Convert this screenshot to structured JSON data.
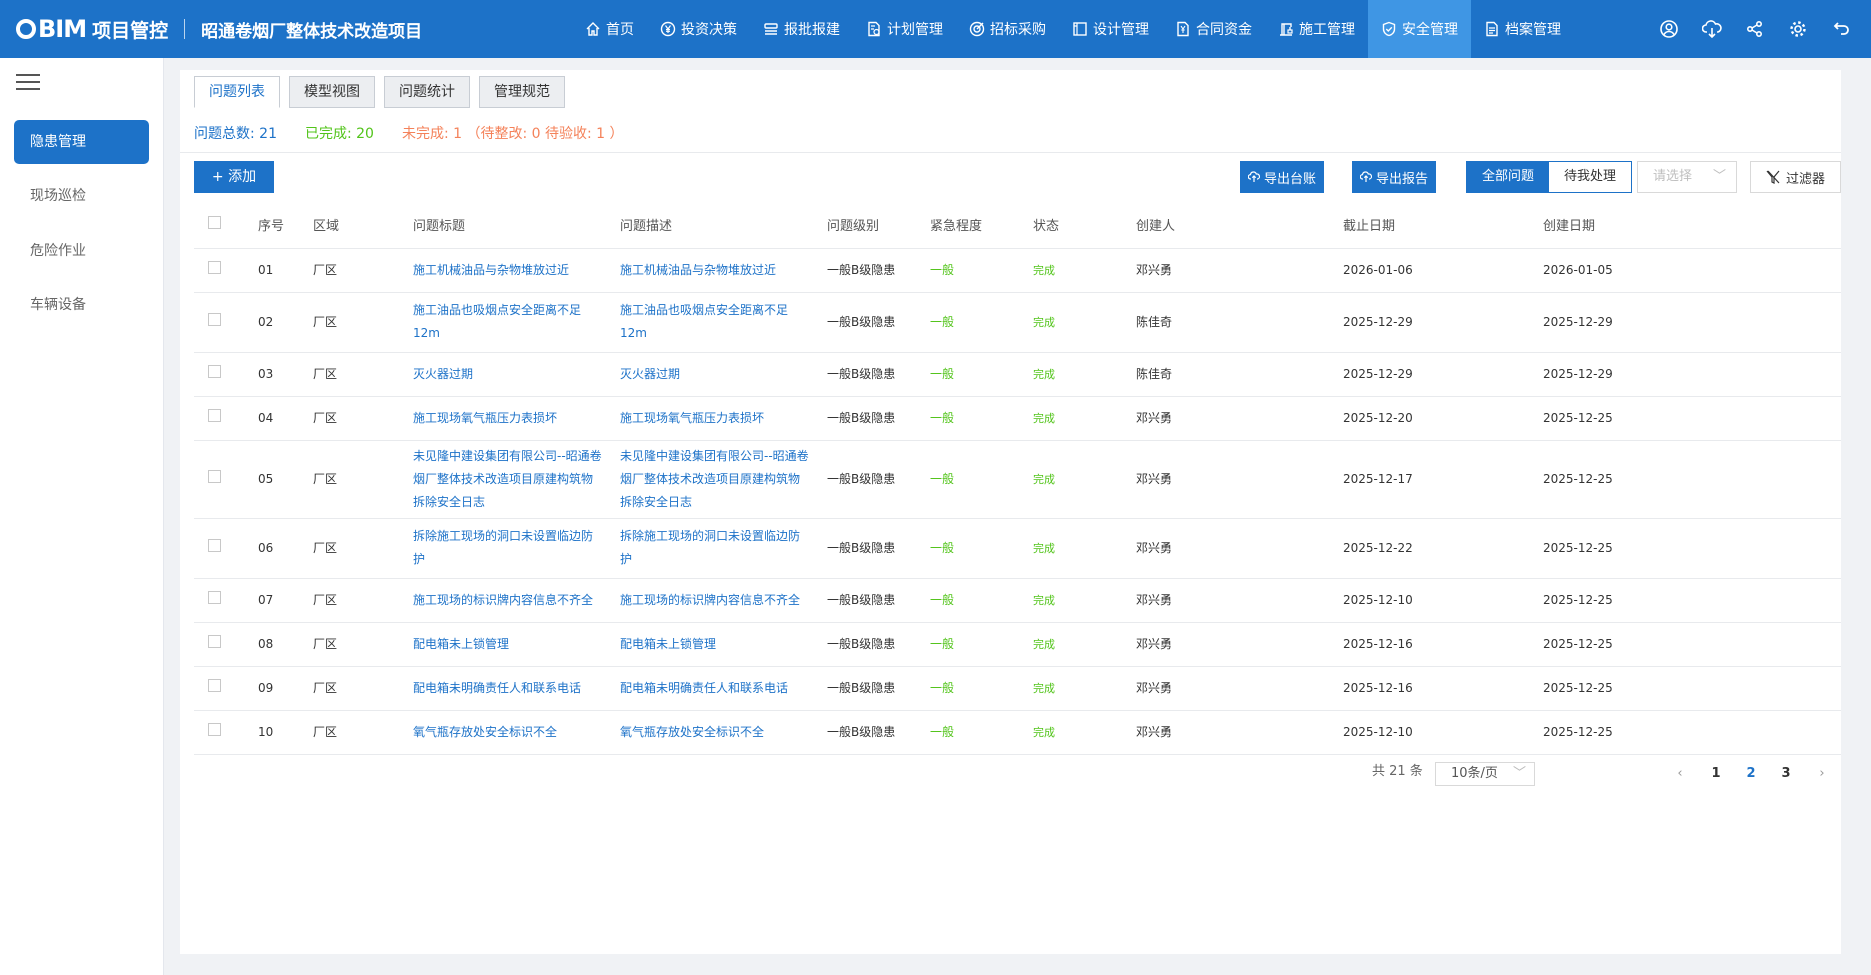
{
  "header": {
    "logo_text": "BIM",
    "brand": "项目管控",
    "project": "昭通卷烟厂整体技术改造项目",
    "nav": [
      {
        "label": "首页",
        "icon": "home-icon"
      },
      {
        "label": "投资决策",
        "icon": "yen-circle-icon"
      },
      {
        "label": "报批报建",
        "icon": "stack-icon"
      },
      {
        "label": "计划管理",
        "icon": "document-icon"
      },
      {
        "label": "招标采购",
        "icon": "target-icon"
      },
      {
        "label": "设计管理",
        "icon": "design-frame-icon"
      },
      {
        "label": "合同资金",
        "icon": "contract-yen-icon"
      },
      {
        "label": "施工管理",
        "icon": "crane-icon"
      },
      {
        "label": "安全管理",
        "icon": "shield-check-icon"
      },
      {
        "label": "档案管理",
        "icon": "archive-icon"
      }
    ],
    "active_nav": 8
  },
  "sidebar": {
    "items": [
      "隐患管理",
      "现场巡检",
      "危险作业",
      "车辆设备"
    ],
    "active": 0
  },
  "tabs": [
    "问题列表",
    "模型视图",
    "问题统计",
    "管理规范"
  ],
  "summary": {
    "total": "问题总数: 21",
    "done": "已完成: 20",
    "undone": "未完成: 1 （待整改: 0  待验收: 1 ）"
  },
  "toolbar": {
    "add": "+ 添加",
    "export_ledger": "导出台账",
    "export_report": "导出报告",
    "all_issues": "全部问题",
    "pending": "待我处理",
    "select_placeholder": "请选择",
    "filter": "过滤器"
  },
  "table": {
    "headers": [
      "序号",
      "区域",
      "问题标题",
      "问题描述",
      "问题级别",
      "紧急程度",
      "状态",
      "创建人",
      "截止日期",
      "创建日期"
    ],
    "rows": [
      {
        "no": "01",
        "area": "厂区",
        "title": "施工机械油品与杂物堆放过近",
        "desc": "施工机械油品与杂物堆放过近",
        "level": "一般B级隐患",
        "urgency": "一般",
        "status": "完成",
        "creator": "邓兴勇",
        "due": "2026-01-06",
        "created": "2026-01-05"
      },
      {
        "no": "02",
        "area": "厂区",
        "title": "施工油品也吸烟点安全距离不足12m",
        "desc": "施工油品也吸烟点安全距离不足12m",
        "level": "一般B级隐患",
        "urgency": "一般",
        "status": "完成",
        "creator": "陈佳奇",
        "due": "2025-12-29",
        "created": "2025-12-29"
      },
      {
        "no": "03",
        "area": "厂区",
        "title": "灭火器过期",
        "desc": "灭火器过期",
        "level": "一般B级隐患",
        "urgency": "一般",
        "status": "完成",
        "creator": "陈佳奇",
        "due": "2025-12-29",
        "created": "2025-12-29"
      },
      {
        "no": "04",
        "area": "厂区",
        "title": "施工现场氧气瓶压力表损坏",
        "desc": "施工现场氧气瓶压力表损坏",
        "level": "一般B级隐患",
        "urgency": "一般",
        "status": "完成",
        "creator": "邓兴勇",
        "due": "2025-12-20",
        "created": "2025-12-25"
      },
      {
        "no": "05",
        "area": "厂区",
        "title": "未见隆中建设集团有限公司--昭通卷烟厂整体技术改造项目原建构筑物拆除安全日志",
        "desc": "未见隆中建设集团有限公司--昭通卷烟厂整体技术改造项目原建构筑物拆除安全日志",
        "level": "一般B级隐患",
        "urgency": "一般",
        "status": "完成",
        "creator": "邓兴勇",
        "due": "2025-12-17",
        "created": "2025-12-25"
      },
      {
        "no": "06",
        "area": "厂区",
        "title": "拆除施工现场的洞口未设置临边防护",
        "desc": "拆除施工现场的洞口未设置临边防护",
        "level": "一般B级隐患",
        "urgency": "一般",
        "status": "完成",
        "creator": "邓兴勇",
        "due": "2025-12-22",
        "created": "2025-12-25"
      },
      {
        "no": "07",
        "area": "厂区",
        "title": "施工现场的标识牌内容信息不齐全",
        "desc": "施工现场的标识牌内容信息不齐全",
        "level": "一般B级隐患",
        "urgency": "一般",
        "status": "完成",
        "creator": "邓兴勇",
        "due": "2025-12-10",
        "created": "2025-12-25"
      },
      {
        "no": "08",
        "area": "厂区",
        "title": "配电箱未上锁管理",
        "desc": "配电箱未上锁管理",
        "level": "一般B级隐患",
        "urgency": "一般",
        "status": "完成",
        "creator": "邓兴勇",
        "due": "2025-12-16",
        "created": "2025-12-25"
      },
      {
        "no": "09",
        "area": "厂区",
        "title": "配电箱未明确责任人和联系电话",
        "desc": "配电箱未明确责任人和联系电话",
        "level": "一般B级隐患",
        "urgency": "一般",
        "status": "完成",
        "creator": "邓兴勇",
        "due": "2025-12-16",
        "created": "2025-12-25"
      },
      {
        "no": "10",
        "area": "厂区",
        "title": "氧气瓶存放处安全标识不全",
        "desc": "氧气瓶存放处安全标识不全",
        "level": "一般B级隐患",
        "urgency": "一般",
        "status": "完成",
        "creator": "邓兴勇",
        "due": "2025-12-10",
        "created": "2025-12-25"
      }
    ]
  },
  "pagination": {
    "total": "共 21 条",
    "page_size": "10条/页",
    "pages": [
      "1",
      "2",
      "3"
    ],
    "current": 1
  },
  "colors": {
    "primary": "#1d72c8",
    "done": "#52c41a",
    "undone": "#f4825a"
  }
}
